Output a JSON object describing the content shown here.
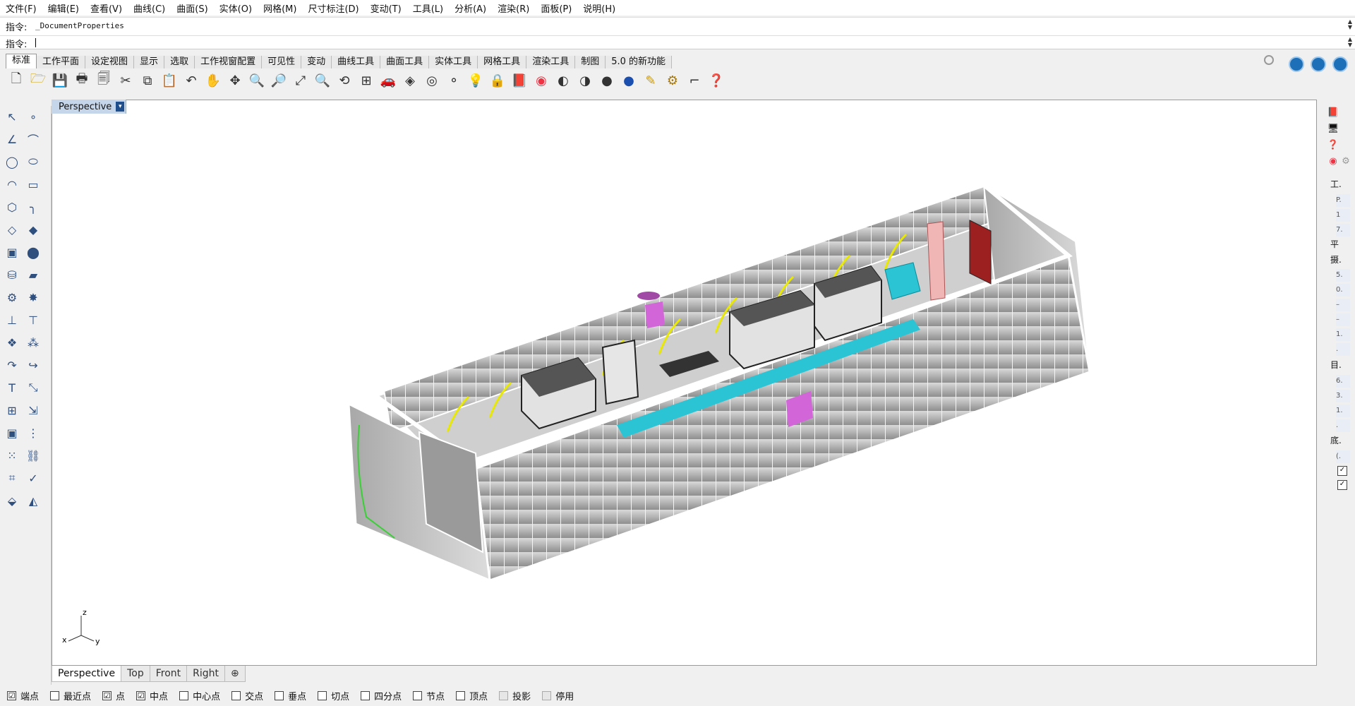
{
  "menu": [
    "文件(F)",
    "编辑(E)",
    "查看(V)",
    "曲线(C)",
    "曲面(S)",
    "实体(O)",
    "网格(M)",
    "尺寸标注(D)",
    "变动(T)",
    "工具(L)",
    "分析(A)",
    "渲染(R)",
    "面板(P)",
    "说明(H)"
  ],
  "command": {
    "history_label": "指令:",
    "history_value": "_DocumentProperties",
    "prompt_label": "指令:"
  },
  "toolbar_tabs": [
    "标准",
    "工作平面",
    "设定视图",
    "显示",
    "选取",
    "工作视窗配置",
    "可见性",
    "变动",
    "曲线工具",
    "曲面工具",
    "实体工具",
    "网格工具",
    "渲染工具",
    "制图",
    "5.0 的新功能"
  ],
  "viewport": {
    "title": "Perspective",
    "dropdown": "▾"
  },
  "view_tabs": [
    "Perspective",
    "Top",
    "Front",
    "Right",
    "⊕"
  ],
  "osnap": [
    {
      "label": "端点",
      "checked": "☑"
    },
    {
      "label": "最近点",
      "checked": ""
    },
    {
      "label": "点",
      "checked": "☑"
    },
    {
      "label": "中点",
      "checked": "☑"
    },
    {
      "label": "中心点",
      "checked": ""
    },
    {
      "label": "交点",
      "checked": ""
    },
    {
      "label": "垂点",
      "checked": ""
    },
    {
      "label": "切点",
      "checked": ""
    },
    {
      "label": "四分点",
      "checked": ""
    },
    {
      "label": "节点",
      "checked": ""
    },
    {
      "label": "顶点",
      "checked": ""
    },
    {
      "label": "投影",
      "checked": ""
    },
    {
      "label": "停用",
      "checked": ""
    }
  ],
  "right_panel": {
    "labels": [
      "工.",
      "P.",
      "1",
      "7.",
      "平",
      "摄.",
      "5.",
      "0.",
      "–",
      "–",
      "1.",
      ".",
      "目.",
      "6.",
      "3.",
      "1.",
      ".",
      "底.",
      "(."
    ]
  },
  "axis": {
    "z": "z",
    "x": "x",
    "y": "y"
  },
  "colors": {
    "viewport_tab": "#c6d6ea",
    "accent": "#1f4e8c",
    "cyan": "#2bc4d4",
    "magenta": "#d266d8",
    "yellow": "#e8e800"
  }
}
